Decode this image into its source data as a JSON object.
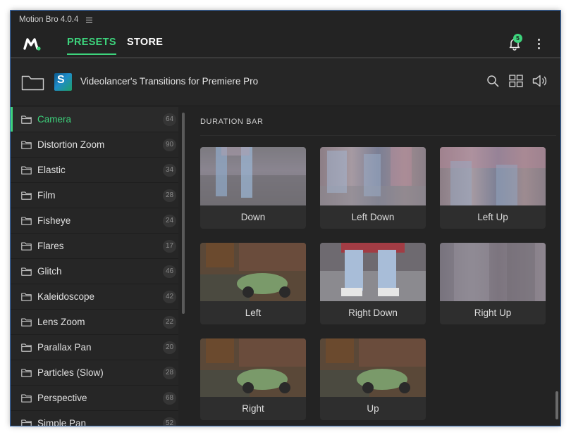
{
  "window": {
    "title": "Motion Bro 4.0.4"
  },
  "nav": {
    "presets": "PRESETS",
    "store": "STORE",
    "notification_count": "5"
  },
  "pack": {
    "title": "Videolancer's Transitions for Premiere Pro",
    "thumb_letter": "S"
  },
  "colors": {
    "accent": "#3dd37c",
    "background": "#232323"
  },
  "sidebar": {
    "items": [
      {
        "label": "Camera",
        "count": "64",
        "active": true
      },
      {
        "label": "Distortion Zoom",
        "count": "90"
      },
      {
        "label": "Elastic",
        "count": "34"
      },
      {
        "label": "Film",
        "count": "28"
      },
      {
        "label": "Fisheye",
        "count": "24"
      },
      {
        "label": "Flares",
        "count": "17"
      },
      {
        "label": "Glitch",
        "count": "46"
      },
      {
        "label": "Kaleidoscope",
        "count": "42"
      },
      {
        "label": "Lens Zoom",
        "count": "22"
      },
      {
        "label": "Parallax Pan",
        "count": "20"
      },
      {
        "label": "Particles (Slow)",
        "count": "28"
      },
      {
        "label": "Perspective",
        "count": "68"
      },
      {
        "label": "Simple Pan",
        "count": "52"
      }
    ]
  },
  "main": {
    "section_title": "DURATION BAR",
    "presets": [
      {
        "label": "Down"
      },
      {
        "label": "Left Down"
      },
      {
        "label": "Left Up"
      },
      {
        "label": "Left"
      },
      {
        "label": "Right Down"
      },
      {
        "label": "Right Up"
      },
      {
        "label": "Right"
      },
      {
        "label": "Up"
      }
    ]
  },
  "icons": {
    "logo": "motion-bro-logo",
    "bell": "bell-icon",
    "more": "more-vertical-icon",
    "folder": "folder-icon",
    "search": "search-icon",
    "grid": "grid-view-icon",
    "sound": "speaker-icon"
  }
}
